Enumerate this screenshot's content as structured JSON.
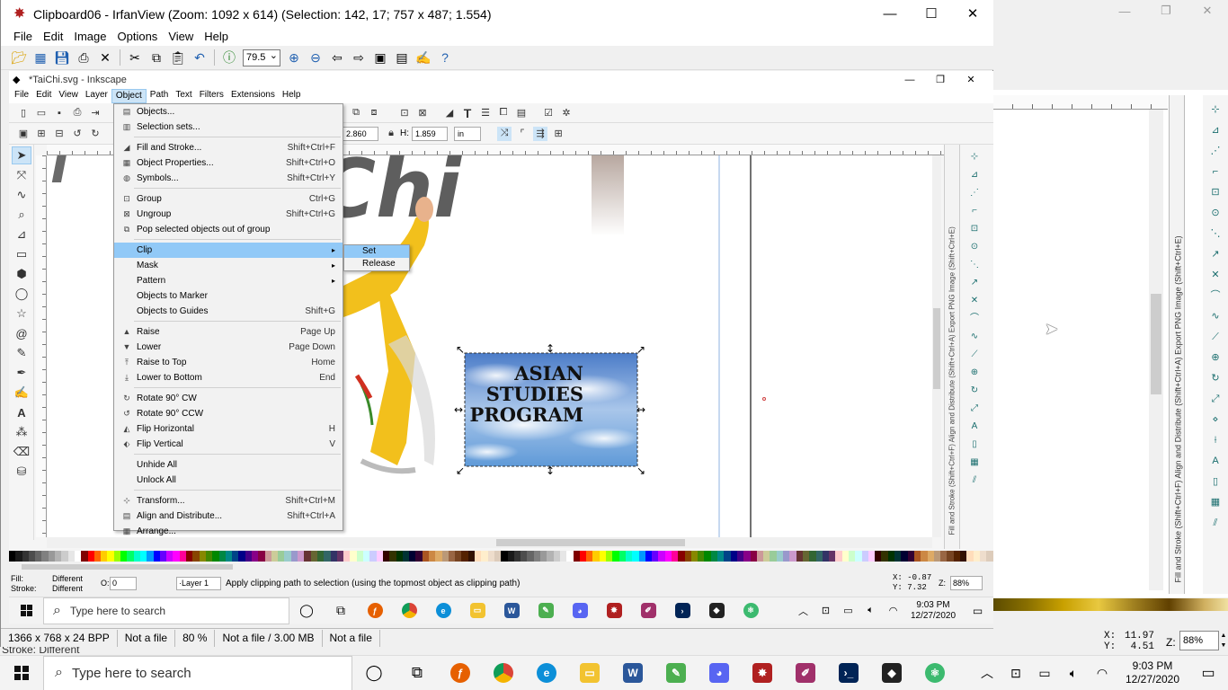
{
  "outer": {
    "win_controls": [
      "—",
      "❐",
      "✕"
    ],
    "dock_vtext": "Fill and Stroke (Shift+Ctrl+F)   Align and Distribute (Shift+Ctrl+A)   Export PNG Image (Shift+Ctrl+E)",
    "coord_x_label": "X:",
    "coord_x": "11.97",
    "coord_y_label": "Y:",
    "coord_y": "4.51",
    "zoom_label": "Z:",
    "zoom": "88%",
    "fill_fragment": "Stroke:    Different",
    "colors": {
      "palette_dominant": "#c8a000"
    }
  },
  "taskbar": {
    "search_placeholder": "Type here to search",
    "time": "9:03 PM",
    "date": "12/27/2020"
  },
  "irfanview": {
    "title": "Clipboard06 - IrfanView (Zoom: 1092 x 614) (Selection: 142, 17; 757 x 487; 1.554)",
    "menu": [
      "File",
      "Edit",
      "Image",
      "Options",
      "View",
      "Help"
    ],
    "zoom_value": "79.5",
    "status": [
      "1366 x 768 x 24 BPP",
      "Not a file",
      "80 %",
      "Not a file / 3.00 MB",
      "Not a file"
    ]
  },
  "inkscape": {
    "title": "*TaiChi.svg - Inkscape",
    "menu": [
      "File",
      "Edit",
      "View",
      "Layer",
      "Object",
      "Path",
      "Text",
      "Filters",
      "Extensions",
      "Help"
    ],
    "active_menu": "Object",
    "w_label": "W:",
    "w_value": "2.860",
    "h_label": "H:",
    "h_value": "1.859",
    "unit": "in",
    "dock_vtext": "Fill and Stroke (Shift+Ctrl+F)   Align and Distribute (Shift+Ctrl+A)   Export PNG Image (Shift+Ctrl+E)",
    "canvas": {
      "logo_text_1": "ASIAN",
      "logo_text_2": "STUDIES",
      "logo_text_3": "PROGRAM",
      "bg_word": "Chi",
      "bg_word_left": "i"
    },
    "status": {
      "fill_label": "Fill:",
      "fill_value": "Different",
      "stroke_label": "Stroke:",
      "stroke_value": "Different",
      "opacity_label": "O:",
      "opacity_value": "0",
      "layer": "·Layer 1",
      "message": "Apply clipping path to selection (using the topmost object as clipping path)",
      "x_label": "X:",
      "x_value": "-0.87",
      "y_label": "Y:",
      "y_value": "7.32",
      "zoom_label": "Z:",
      "zoom_value": "88%"
    },
    "object_menu": [
      {
        "label": "Objects...",
        "shortcut": "",
        "icon": "objects-icon"
      },
      {
        "label": "Selection sets...",
        "shortcut": "",
        "icon": "selection-sets-icon"
      },
      {
        "sep": true
      },
      {
        "label": "Fill and Stroke...",
        "shortcut": "Shift+Ctrl+F",
        "icon": "fill-stroke-icon"
      },
      {
        "label": "Object Properties...",
        "shortcut": "Shift+Ctrl+O",
        "icon": "object-properties-icon"
      },
      {
        "label": "Symbols...",
        "shortcut": "Shift+Ctrl+Y",
        "icon": "symbols-icon"
      },
      {
        "sep": true
      },
      {
        "label": "Group",
        "shortcut": "Ctrl+G",
        "icon": "group-icon"
      },
      {
        "label": "Ungroup",
        "shortcut": "Shift+Ctrl+G",
        "icon": "ungroup-icon"
      },
      {
        "label": "Pop selected objects out of group",
        "shortcut": "",
        "icon": "pop-out-icon"
      },
      {
        "sep": true
      },
      {
        "label": "Clip",
        "shortcut": "",
        "icon": "",
        "submenu": true,
        "highlight": true
      },
      {
        "label": "Mask",
        "shortcut": "",
        "icon": "",
        "submenu": true
      },
      {
        "label": "Pattern",
        "shortcut": "",
        "icon": "",
        "submenu": true
      },
      {
        "label": "Objects to Marker",
        "shortcut": "",
        "icon": ""
      },
      {
        "label": "Objects to Guides",
        "shortcut": "Shift+G",
        "icon": ""
      },
      {
        "sep": true
      },
      {
        "label": "Raise",
        "shortcut": "Page Up",
        "icon": "raise-icon"
      },
      {
        "label": "Lower",
        "shortcut": "Page Down",
        "icon": "lower-icon"
      },
      {
        "label": "Raise to Top",
        "shortcut": "Home",
        "icon": "raise-top-icon"
      },
      {
        "label": "Lower to Bottom",
        "shortcut": "End",
        "icon": "lower-bottom-icon"
      },
      {
        "sep": true
      },
      {
        "label": "Rotate 90° CW",
        "shortcut": "",
        "icon": "rotate-cw-icon"
      },
      {
        "label": "Rotate 90° CCW",
        "shortcut": "",
        "icon": "rotate-ccw-icon"
      },
      {
        "label": "Flip Horizontal",
        "shortcut": "H",
        "icon": "flip-h-icon"
      },
      {
        "label": "Flip Vertical",
        "shortcut": "V",
        "icon": "flip-v-icon"
      },
      {
        "sep": true
      },
      {
        "label": "Unhide All",
        "shortcut": "",
        "icon": ""
      },
      {
        "label": "Unlock All",
        "shortcut": "",
        "icon": ""
      },
      {
        "sep": true
      },
      {
        "label": "Transform...",
        "shortcut": "Shift+Ctrl+M",
        "icon": "transform-icon"
      },
      {
        "label": "Align and Distribute...",
        "shortcut": "Shift+Ctrl+A",
        "icon": "align-icon"
      },
      {
        "label": "Arrange...",
        "shortcut": "",
        "icon": "arrange-icon"
      }
    ],
    "clip_submenu": [
      {
        "label": "Set",
        "highlight": true
      },
      {
        "label": "Release"
      }
    ]
  },
  "inner_taskbar": {
    "search_placeholder": "Type here to search",
    "time": "9:03 PM",
    "date": "12/27/2020"
  }
}
